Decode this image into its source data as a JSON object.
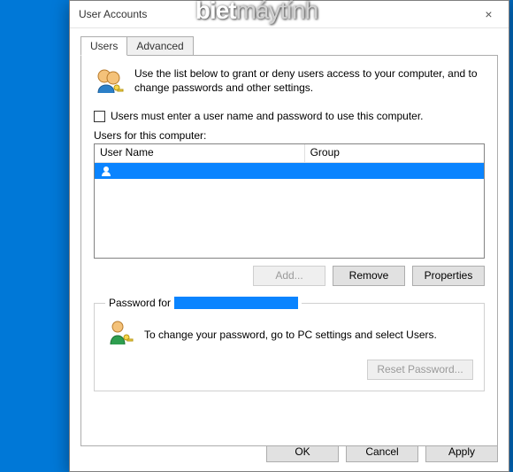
{
  "watermark": {
    "part1": "biet",
    "part2": "máytính"
  },
  "window": {
    "title": "User Accounts",
    "close_glyph": "×"
  },
  "tabs": {
    "users": "Users",
    "advanced": "Advanced"
  },
  "intro": "Use the list below to grant or deny users access to your computer, and to change passwords and other settings.",
  "checkbox_label": "Users must enter a user name and password to use this computer.",
  "list_label": "Users for this computer:",
  "columns": {
    "username": "User Name",
    "group": "Group"
  },
  "row": {
    "username": "",
    "group": ""
  },
  "buttons": {
    "add": "Add...",
    "remove": "Remove",
    "properties": "Properties",
    "reset_pw": "Reset Password...",
    "ok": "OK",
    "cancel": "Cancel",
    "apply": "Apply"
  },
  "password_group": {
    "label_prefix": "Password for",
    "redacted_user": "",
    "text": "To change your password, go to PC settings and select Users."
  }
}
